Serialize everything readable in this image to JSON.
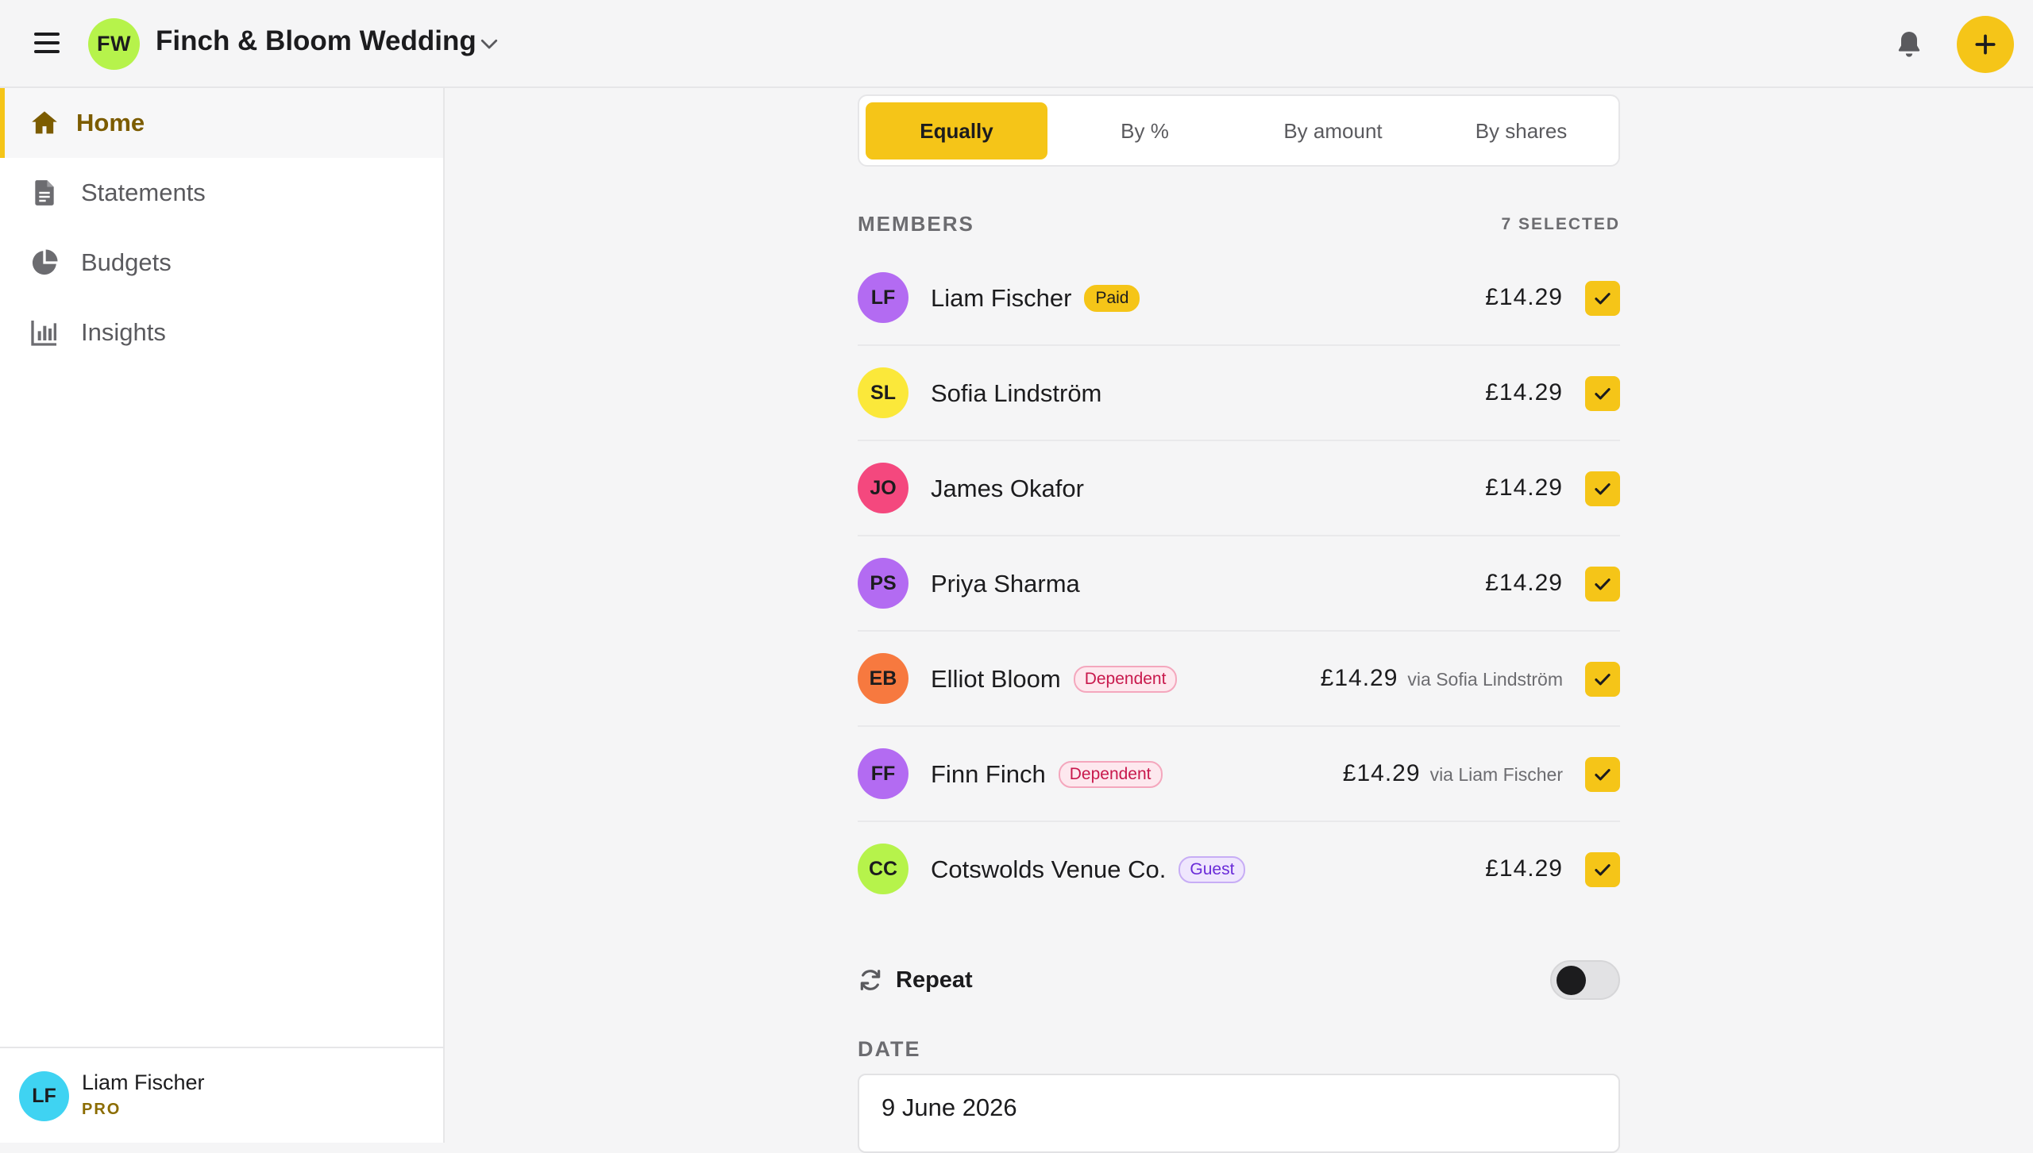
{
  "header": {
    "group_initials": "FW",
    "group_name": "Finch & Bloom Wedding",
    "menu_icon": "hamburger-icon",
    "notification_icon": "bell-icon",
    "add_icon": "plus-icon",
    "accent_color": "#f5c518"
  },
  "sidebar": {
    "items": [
      {
        "label": "Home",
        "icon": "home-icon",
        "active": true
      },
      {
        "label": "Statements",
        "icon": "document-icon",
        "active": false
      },
      {
        "label": "Budgets",
        "icon": "pie-chart-icon",
        "active": false
      },
      {
        "label": "Insights",
        "icon": "bar-chart-icon",
        "active": false
      }
    ],
    "user": {
      "initials": "LF",
      "name": "Liam Fischer",
      "plan": "PRO",
      "avatar_color": "#3fd3f2"
    }
  },
  "split": {
    "tabs": [
      "Equally",
      "By %",
      "By amount",
      "By shares"
    ],
    "selected": "Equally"
  },
  "members": {
    "header": "MEMBERS",
    "count_label": "7 SELECTED",
    "rows": [
      {
        "initials": "LF",
        "name": "Liam Fischer",
        "badge": "Paid",
        "badge_type": "paid",
        "amount": "£14.29",
        "via": "",
        "color": "#b36bf2",
        "checked": true
      },
      {
        "initials": "SL",
        "name": "Sofia Lindström",
        "badge": "",
        "badge_type": "",
        "amount": "£14.29",
        "via": "",
        "color": "#fbe83a",
        "checked": true
      },
      {
        "initials": "JO",
        "name": "James Okafor",
        "badge": "",
        "badge_type": "",
        "amount": "£14.29",
        "via": "",
        "color": "#f4487e",
        "checked": true
      },
      {
        "initials": "PS",
        "name": "Priya Sharma",
        "badge": "",
        "badge_type": "",
        "amount": "£14.29",
        "via": "",
        "color": "#b36bf2",
        "checked": true
      },
      {
        "initials": "EB",
        "name": "Elliot Bloom",
        "badge": "Dependent",
        "badge_type": "dependent",
        "amount": "£14.29",
        "via": "via Sofia Lindström",
        "color": "#f7793f",
        "checked": true
      },
      {
        "initials": "FF",
        "name": "Finn Finch",
        "badge": "Dependent",
        "badge_type": "dependent",
        "amount": "£14.29",
        "via": "via Liam Fischer",
        "color": "#b36bf2",
        "checked": true
      },
      {
        "initials": "CC",
        "name": "Cotswolds Venue Co.",
        "badge": "Guest",
        "badge_type": "guest",
        "amount": "£14.29",
        "via": "",
        "color": "#b6f34b",
        "checked": true
      }
    ]
  },
  "repeat": {
    "label": "Repeat",
    "icon": "refresh-icon",
    "enabled": false
  },
  "date": {
    "label": "DATE",
    "value": "9 June 2026"
  }
}
